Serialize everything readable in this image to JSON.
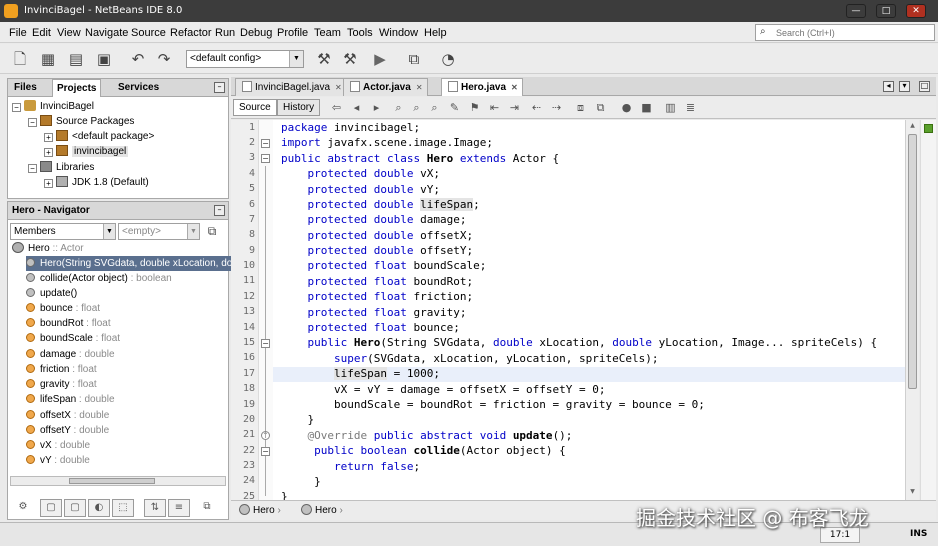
{
  "window": {
    "title": "InvinciBagel - NetBeans IDE 8.0",
    "ctrl_min": "—",
    "ctrl_max": "□",
    "ctrl_close": "✕"
  },
  "menu": [
    "File",
    "Edit",
    "View",
    "Navigate",
    "Source",
    "Refactor",
    "Run",
    "Debug",
    "Profile",
    "Team",
    "Tools",
    "Window",
    "Help"
  ],
  "search": {
    "placeholder": "Search (Ctrl+I)"
  },
  "toolbar": {
    "config": "<default config>"
  },
  "projects_panel": {
    "tabs": [
      "Files",
      "Projects",
      "Services"
    ],
    "tree": [
      {
        "label": "InvinciBagel"
      },
      {
        "label": "Source Packages"
      },
      {
        "label": "<default package>"
      },
      {
        "label": "invincibagel"
      },
      {
        "label": "Libraries"
      },
      {
        "label": "JDK 1.8 (Default)"
      }
    ]
  },
  "navigator": {
    "title": "Hero - Navigator",
    "filter": "Members",
    "scope": "<empty>",
    "root": {
      "name": "Hero",
      "type": " :: Actor"
    },
    "members": [
      {
        "name": "Hero(String SVGdata, double xLocation, dou",
        "type": ""
      },
      {
        "name": "collide(Actor object)",
        "type": " : boolean"
      },
      {
        "name": "update()",
        "type": ""
      },
      {
        "name": "bounce",
        "type": " : float"
      },
      {
        "name": "boundRot",
        "type": " : float"
      },
      {
        "name": "boundScale",
        "type": " : float"
      },
      {
        "name": "damage",
        "type": " : double"
      },
      {
        "name": "friction",
        "type": " : float"
      },
      {
        "name": "gravity",
        "type": " : float"
      },
      {
        "name": "lifeSpan",
        "type": " : double"
      },
      {
        "name": "offsetX",
        "type": " : double"
      },
      {
        "name": "offsetY",
        "type": " : double"
      },
      {
        "name": "vX",
        "type": " : double"
      },
      {
        "name": "vY",
        "type": " : double"
      }
    ]
  },
  "editor": {
    "tabs": [
      "InvinciBagel.java",
      "Actor.java",
      "Hero.java"
    ],
    "source_btn": "Source",
    "history_btn": "History",
    "lines": [
      {
        "n": "1",
        "text": "package invincibagel;"
      },
      {
        "n": "2",
        "text": "import javafx.scene.image.Image;"
      },
      {
        "n": "3",
        "text": "public abstract class Hero extends Actor {"
      },
      {
        "n": "4",
        "text": "    protected double vX;"
      },
      {
        "n": "5",
        "text": "    protected double vY;"
      },
      {
        "n": "6",
        "text": "    protected double lifeSpan;"
      },
      {
        "n": "7",
        "text": "    protected double damage;"
      },
      {
        "n": "8",
        "text": "    protected double offsetX;"
      },
      {
        "n": "9",
        "text": "    protected double offsetY;"
      },
      {
        "n": "10",
        "text": "    protected float boundScale;"
      },
      {
        "n": "11",
        "text": "    protected float boundRot;"
      },
      {
        "n": "12",
        "text": "    protected float friction;"
      },
      {
        "n": "13",
        "text": "    protected float gravity;"
      },
      {
        "n": "14",
        "text": "    protected float bounce;"
      },
      {
        "n": "15",
        "text": "    public Hero(String SVGdata, double xLocation, double yLocation, Image... spriteCels) {"
      },
      {
        "n": "16",
        "text": "        super(SVGdata, xLocation, yLocation, spriteCels);"
      },
      {
        "n": "17",
        "text": "        lifeSpan = 1000;"
      },
      {
        "n": "18",
        "text": "        vX = vY = damage = offsetX = offsetY = 0;"
      },
      {
        "n": "19",
        "text": "        boundScale = boundRot = friction = gravity = bounce = 0;"
      },
      {
        "n": "20",
        "text": "    }"
      },
      {
        "n": "21",
        "text": "    @Override public abstract void update();"
      },
      {
        "n": "22",
        "text": "     public boolean collide(Actor object) {"
      },
      {
        "n": "23",
        "text": "        return false;"
      },
      {
        "n": "24",
        "text": "     }"
      },
      {
        "n": "25",
        "text": "}"
      }
    ]
  },
  "breadcrumbs": [
    "Hero",
    "Hero"
  ],
  "status": {
    "position": "17:1",
    "mode": "INS"
  },
  "watermark": "掘金技术社区 @ 布客飞龙"
}
